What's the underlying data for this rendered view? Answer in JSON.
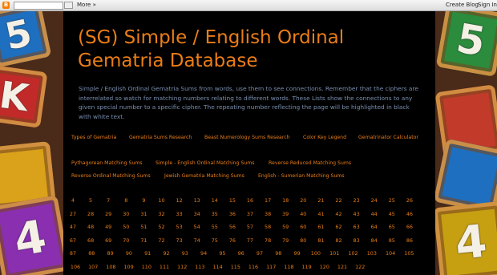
{
  "navbar": {
    "logo": "B",
    "more_label": "More »",
    "create_blog_label": "Create Blog",
    "sign_in_label": "Sign In"
  },
  "header": {
    "title": "(SG) Simple / English Ordinal Gematria Database"
  },
  "description": "Simple / English Ordinal Gematria Sums from words, use them to see connections. Remember that the ciphers are interrelated so watch for matching numbers relating to different words. These Lists show the connections to any given special number to a specific cipher. The repeating number reflecting the page will be highlighted in black with white text.",
  "nav_links": [
    "Types of Gematria",
    "Gematria Sums Research",
    "Beast Numerology Sums Research",
    "Color Key Legend",
    "Gematrinator Calculator",
    "Pythagorean Matching Sums",
    "Simple - English Ordinal Matching Sums",
    "Reverse Reduced Matching Sums",
    "Reverse Ordinal Matching Sums",
    "Jewish Gematria Matching Sums",
    "English - Sumerian Matching Sums"
  ],
  "numbers": [
    "4",
    "5",
    "7",
    "8",
    "9",
    "10",
    "12",
    "13",
    "14",
    "15",
    "16",
    "17",
    "18",
    "20",
    "21",
    "22",
    "23",
    "24",
    "25",
    "26",
    "27",
    "28",
    "29",
    "30",
    "31",
    "32",
    "33",
    "34",
    "35",
    "36",
    "37",
    "38",
    "39",
    "40",
    "41",
    "42",
    "43",
    "44",
    "45",
    "46",
    "47",
    "48",
    "49",
    "50",
    "51",
    "52",
    "53",
    "54",
    "55",
    "56",
    "57",
    "58",
    "59",
    "60",
    "61",
    "62",
    "63",
    "64",
    "65",
    "66",
    "67",
    "68",
    "69",
    "70",
    "71",
    "72",
    "73",
    "74",
    "75",
    "76",
    "77",
    "78",
    "79",
    "80",
    "81",
    "82",
    "83",
    "84",
    "85",
    "86",
    "87",
    "88",
    "89",
    "90",
    "91",
    "92",
    "93",
    "94",
    "95",
    "96",
    "97",
    "98",
    "99",
    "100",
    "101",
    "102",
    "103",
    "104",
    "105",
    "106",
    "107",
    "108",
    "109",
    "110",
    "111",
    "112",
    "113",
    "114",
    "115",
    "116",
    "117",
    "118",
    "119",
    "120",
    "121",
    "122"
  ],
  "background_blocks": [
    "5",
    "K",
    "4",
    "4",
    "5"
  ],
  "colors": {
    "accent": "#ea7d17",
    "text": "#7a8fb0",
    "panel": "#000000"
  }
}
